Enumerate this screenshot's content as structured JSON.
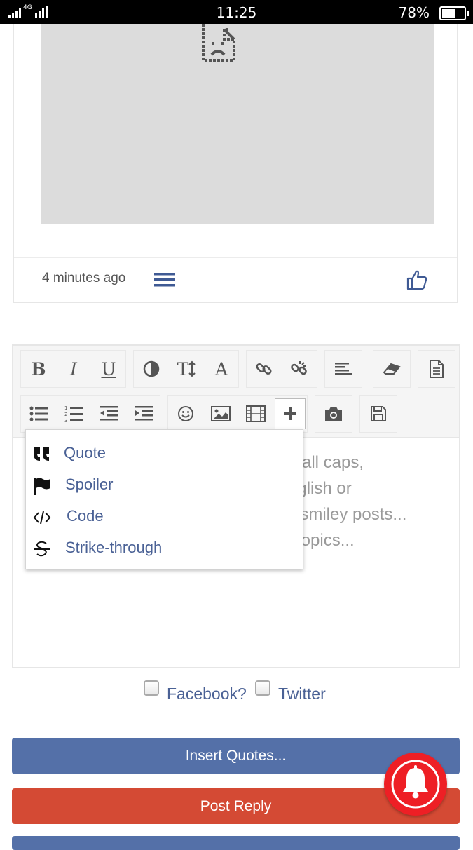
{
  "status_bar": {
    "network": "4G",
    "time": "11:25",
    "battery_pct": "78%",
    "battery_level": 0.78
  },
  "post": {
    "image_state": "broken-image-icon",
    "time": "4 minutes ago"
  },
  "toolbar": {
    "row1": [
      "bold-icon",
      "italic-icon",
      "underline-icon",
      "contrast-icon",
      "text-size-icon",
      "font-color-icon",
      "link-icon",
      "unlink-icon",
      "align-icon",
      "eraser-icon",
      "document-icon"
    ],
    "row2": [
      "bullet-list-icon",
      "numbered-list-icon",
      "outdent-icon",
      "indent-icon",
      "smiley-icon",
      "image-icon",
      "video-icon",
      "plus-icon",
      "camera-icon",
      "save-icon"
    ],
    "bold": "B",
    "italic": "I",
    "underline": "U",
    "text_size": "T",
    "font_color": "A"
  },
  "editor": {
    "placeholder_lines": [
      "t, all caps,",
      "nglish or",
      "ll smiley posts...",
      "l topics..."
    ]
  },
  "dropdown": {
    "items": [
      {
        "icon": "quote-icon",
        "label": "Quote"
      },
      {
        "icon": "flag-icon",
        "label": "Spoiler"
      },
      {
        "icon": "code-icon",
        "label": "Code"
      },
      {
        "icon": "strikethrough-icon",
        "label": "Strike-through"
      }
    ]
  },
  "share": {
    "facebook_label": "Facebook?",
    "twitter_label": "Twitter"
  },
  "buttons": {
    "insert_quotes": "Insert Quotes...",
    "post_reply": "Post Reply"
  },
  "colors": {
    "accent_blue": "#5470a8",
    "reply_red": "#d44a34",
    "bell_red": "#ee1f25",
    "link_blue": "#4a6195"
  }
}
